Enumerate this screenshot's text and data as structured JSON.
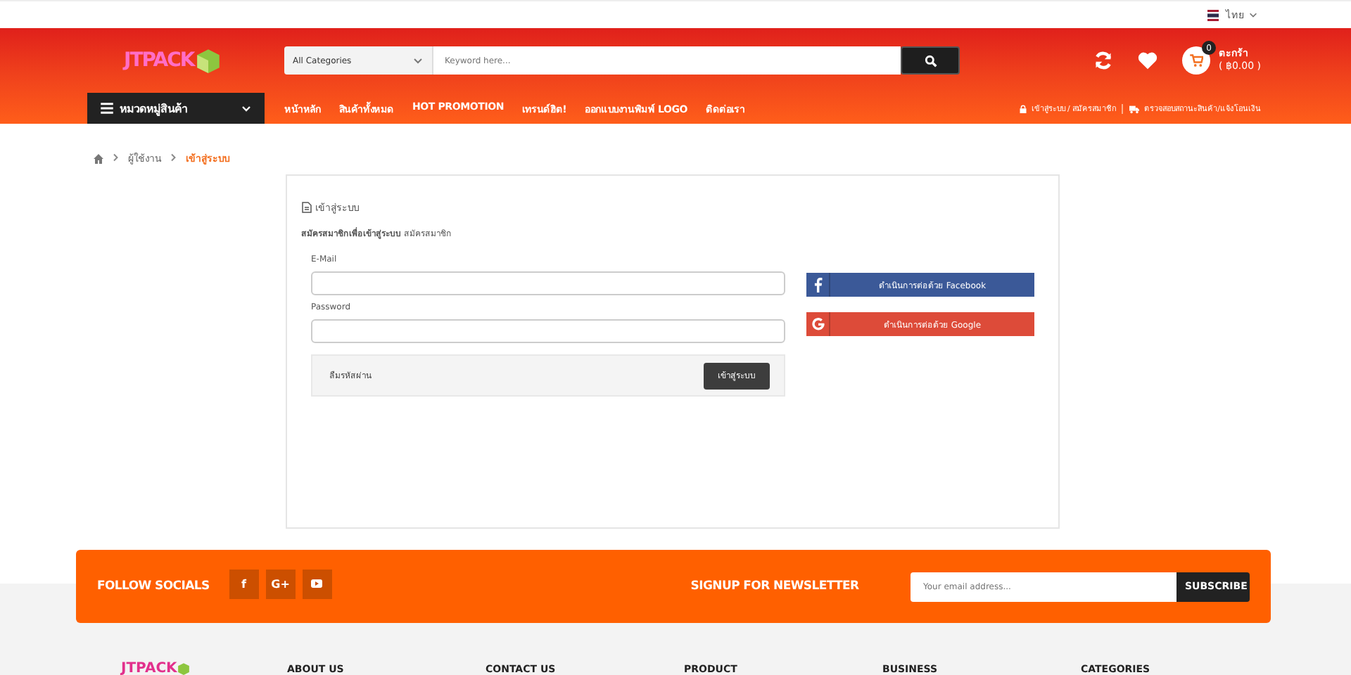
{
  "top_bar": {
    "language": "ไทย"
  },
  "header": {
    "logo": "JTPACK",
    "search": {
      "category": "All Categories",
      "placeholder": "Keyword here..."
    },
    "cart": {
      "count": "0",
      "label": "ตะกร้า",
      "total": "( ฿0.00 )"
    }
  },
  "nav": {
    "category_menu": "หมวดหมู่สินค้า",
    "items": [
      {
        "label": "หน้าหลัก"
      },
      {
        "label": "สินค้าทั้งหมด"
      },
      {
        "label": "HOT PROMOTION"
      },
      {
        "label": "เทรนด์ฮิต!"
      },
      {
        "label": "ออกแบบงานพิมพ์ LOGO"
      },
      {
        "label": "ติดต่อเรา"
      }
    ],
    "account_link": "เข้าสู่ระบบ / สมัครสมาชิก",
    "track_link": "ตรวจสอบสถานะสินค้า/แจ้งโอนเงิน"
  },
  "breadcrumb": [
    {
      "label": "ผู้ใช้งาน",
      "selected": false
    },
    {
      "label": "เข้าสู่ระบบ",
      "selected": true
    }
  ],
  "login": {
    "title": "เข้าสู่ระบบ",
    "intro": "**สมัครสมาชิกเพื่อเข้าสู่ระบบ** สมัครสมาชิก",
    "fields": [
      {
        "label": "E-Mail"
      },
      {
        "label": "Password"
      }
    ],
    "forgot": "ลืมรหัสผ่าน",
    "submit": "เข้าสู่ระบบ",
    "social": [
      {
        "kind": "facebook",
        "label": "ดำเนินการต่อด้วย Facebook",
        "color": "#3b5998"
      },
      {
        "kind": "google",
        "label": "ดำเนินการต่อด้วย Google",
        "color": "#dd4b39"
      }
    ]
  },
  "newsletter": {
    "follow": "FOLLOW SOCIALS",
    "socials": [
      {
        "kind": "facebook",
        "label": "f"
      },
      {
        "kind": "googleplus",
        "label": "G+"
      },
      {
        "kind": "youtube"
      }
    ],
    "title": "SIGNUP FOR NEWSLETTER",
    "placeholder": "Your email address...",
    "button": "SUBSCRIBE"
  },
  "footer": {
    "logo": "JTPACK",
    "columns": [
      "ABOUT US",
      "CONTACT US",
      "PRODUCT",
      "BUSINESS",
      "CATEGORIES"
    ]
  }
}
